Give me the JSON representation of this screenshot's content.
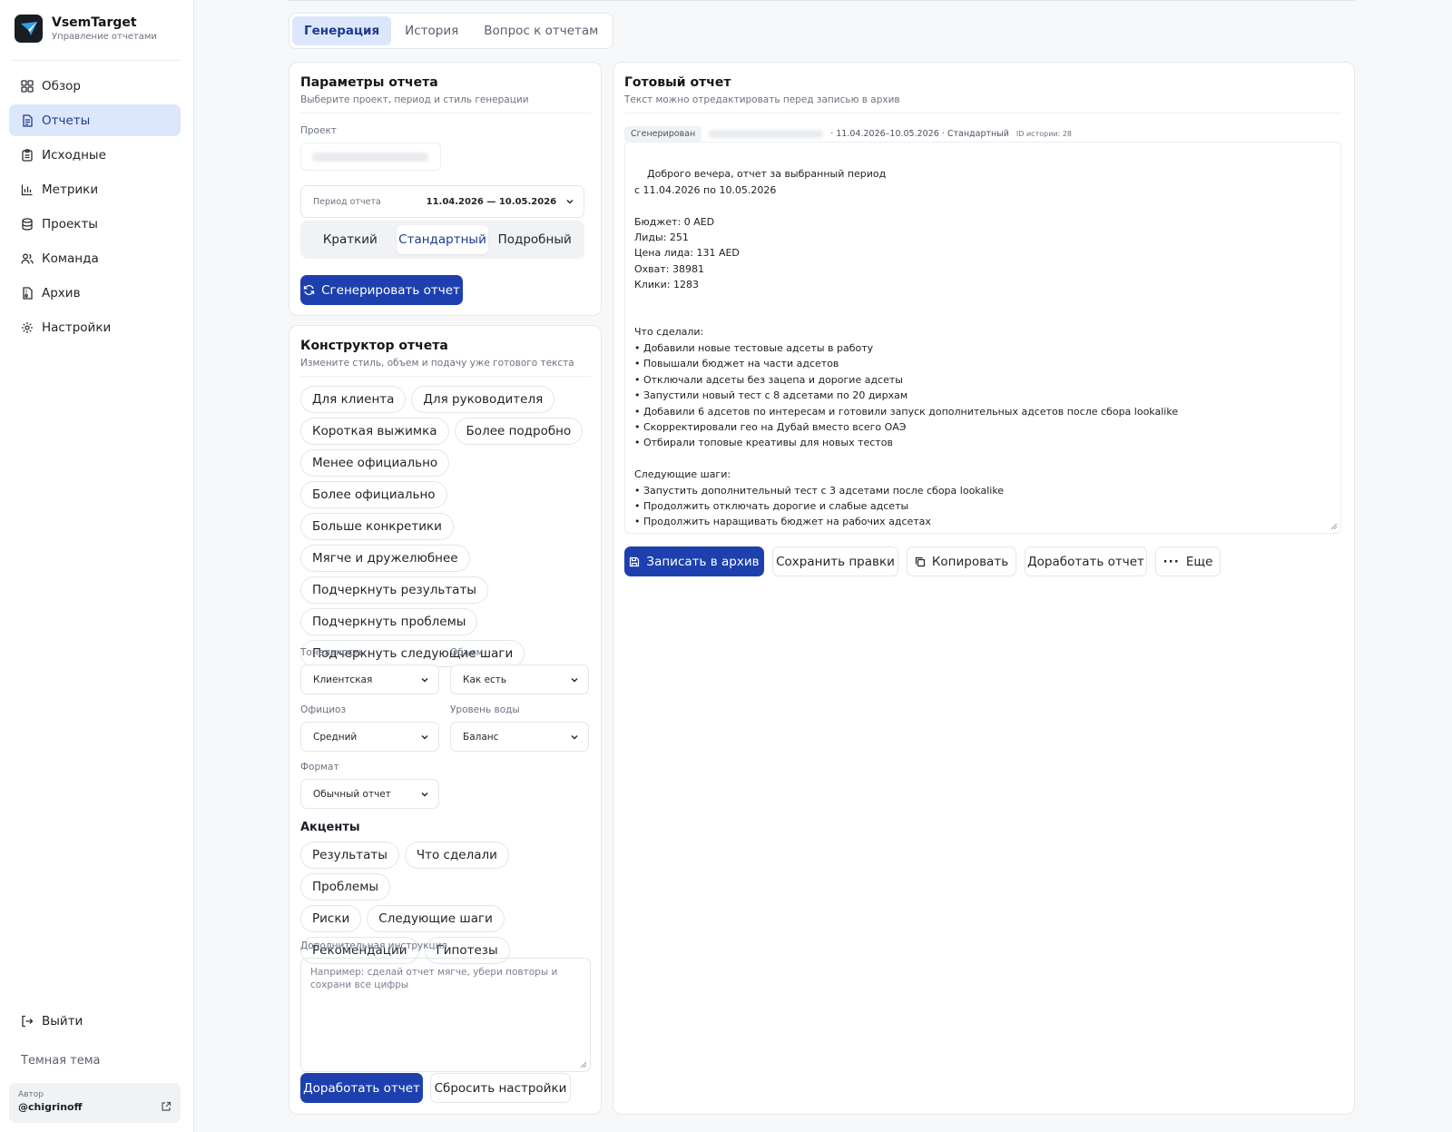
{
  "brand": {
    "name": "VsemTarget",
    "subtitle": "Управление отчетами"
  },
  "sidebar": {
    "items": [
      {
        "label": "Обзор",
        "icon": "grid-icon"
      },
      {
        "label": "Отчеты",
        "icon": "file-text-icon",
        "active": true
      },
      {
        "label": "Исходные",
        "icon": "clipboard-icon"
      },
      {
        "label": "Метрики",
        "icon": "bar-chart-icon"
      },
      {
        "label": "Проекты",
        "icon": "database-icon"
      },
      {
        "label": "Команда",
        "icon": "users-icon"
      },
      {
        "label": "Архив",
        "icon": "archive-file-icon"
      },
      {
        "label": "Настройки",
        "icon": "gear-icon"
      }
    ],
    "logout": "Выйти",
    "theme": "Темная тема",
    "author_label": "Автор",
    "author_name": "@chigrinoff"
  },
  "tabs": [
    "Генерация",
    "История",
    "Вопрос к отчетам"
  ],
  "params": {
    "title": "Параметры отчета",
    "subtitle": "Выберите проект, период и стиль генерации",
    "project_label": "Проект",
    "period_label": "Период отчета",
    "period_value": "11.04.2026 — 10.05.2026",
    "styles": [
      "Краткий",
      "Стандартный",
      "Подробный"
    ],
    "generate_button": "Сгенерировать отчет"
  },
  "constructor": {
    "title": "Конструктор отчета",
    "subtitle": "Измените стиль, объем и подачу уже готового текста",
    "chips": [
      [
        "Для клиента",
        "Для руководителя"
      ],
      [
        "Короткая выжимка",
        "Более подробно"
      ],
      [
        "Менее официально",
        "Более официально"
      ],
      [
        "Больше конкретики"
      ],
      [
        "Мягче и дружелюбнее"
      ],
      [
        "Подчеркнуть результаты"
      ],
      [
        "Подчеркнуть проблемы"
      ],
      [
        "Подчеркнуть следующие шаги"
      ]
    ],
    "tone_label": "Тональность",
    "tone_value": "Клиентская",
    "volume_label": "Объем",
    "volume_value": "Как есть",
    "officialese_label": "Официоз",
    "officialese_value": "Средний",
    "water_label": "Уровень воды",
    "water_value": "Баланс",
    "format_label": "Формат",
    "format_value": "Обычный отчет",
    "accents_title": "Акценты",
    "accents": [
      [
        "Результаты",
        "Что сделали",
        "Проблемы"
      ],
      [
        "Риски",
        "Следующие шаги"
      ],
      [
        "Рекомендации",
        "Гипотезы"
      ]
    ],
    "instruction_label": "Дополнительная инструкция",
    "instruction_placeholder": "Например: сделай отчет мягче, убери повторы и сохрани все цифры",
    "refine_button": "Доработать отчет",
    "reset_button": "Сбросить настройки"
  },
  "report": {
    "title": "Готовый отчет",
    "subtitle": "Текст можно отредактировать перед записью в архив",
    "status_badge": "Сгенерирован",
    "meta": "· 11.04.2026–10.05.2026 · Стандартный",
    "history_id": "ID истории: 28",
    "text": "Доброго вечера, отчет за выбранный период\nс 11.04.2026 по 10.05.2026\n\nБюджет: 0 AED\nЛиды: 251\nЦена лида: 131 AED\nОхват: 38981\nКлики: 1283\n\n\nЧто сделали:\n• Добавили новые тестовые адсеты в работу\n• Повышали бюджет на части адсетов\n• Отключали адсеты без зацепа и дорогие адсеты\n• Запустили новый тест с 8 адсетами по 20 дирхам\n• Добавили 6 адсетов по интересам и готовили запуск дополнительных адсетов после сбора lookalike\n• Скорректировали гео на Дубай вместо всего ОАЭ\n• Отбирали топовые креативы для новых тестов\n\nСледующие шаги:\n• Запустить дополнительный тест с 3 адсетами после сбора lookalike\n• Продолжить отключать дорогие и слабые адсеты\n• Продолжить наращивать бюджет на рабочих адсетах\n• При необходимости протестировать другие офферы",
    "archive_button": "Записать в архив",
    "save_button": "Сохранить правки",
    "copy_button": "Копировать",
    "refine_button": "Доработать отчет",
    "more_button": "Еще"
  },
  "colors": {
    "accent": "#1e40af",
    "active_bg": "#dde7fb"
  }
}
